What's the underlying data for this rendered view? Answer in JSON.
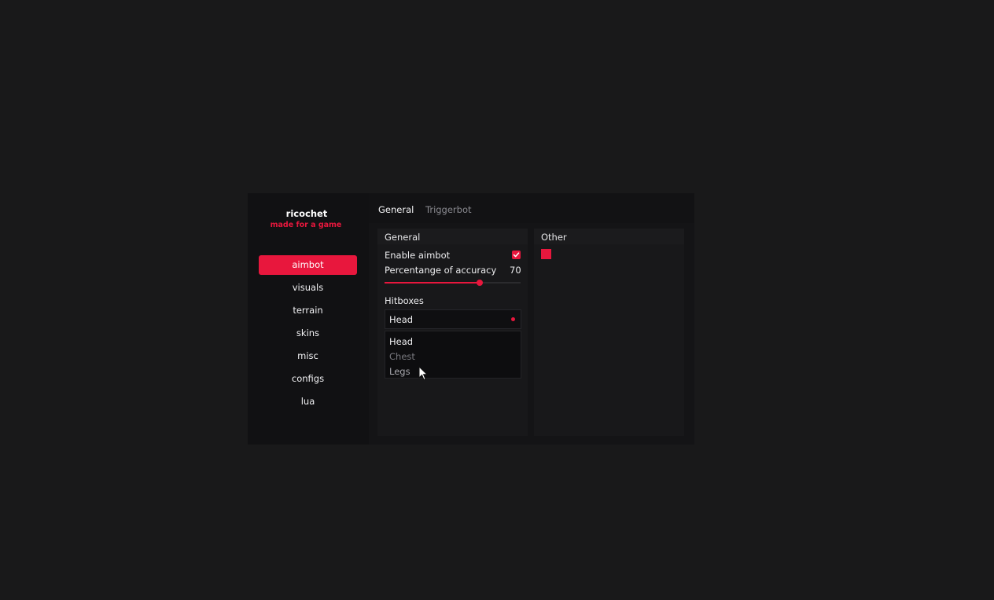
{
  "brand": {
    "title": "ricochet",
    "subtitle": "made for a game"
  },
  "sidebar": {
    "items": [
      {
        "label": "aimbot",
        "active": true
      },
      {
        "label": "visuals",
        "active": false
      },
      {
        "label": "terrain",
        "active": false
      },
      {
        "label": "skins",
        "active": false
      },
      {
        "label": "misc",
        "active": false
      },
      {
        "label": "configs",
        "active": false
      },
      {
        "label": "lua",
        "active": false
      }
    ]
  },
  "tabs": [
    {
      "label": "General",
      "active": true
    },
    {
      "label": "Triggerbot",
      "active": false
    }
  ],
  "general_panel": {
    "title": "General",
    "enable_aimbot": {
      "label": "Enable aimbot",
      "checked": true
    },
    "accuracy": {
      "label": "Percentange of accuracy",
      "value": "70",
      "fraction": 0.7
    },
    "hitboxes": {
      "label": "Hitboxes",
      "selected": "Head",
      "options": [
        "Head",
        "Chest",
        "Legs"
      ]
    }
  },
  "other_panel": {
    "title": "Other",
    "swatch_color": "#e8173d"
  },
  "colors": {
    "accent": "#e8173d",
    "background": "#19191a",
    "panel": "#18181a"
  }
}
